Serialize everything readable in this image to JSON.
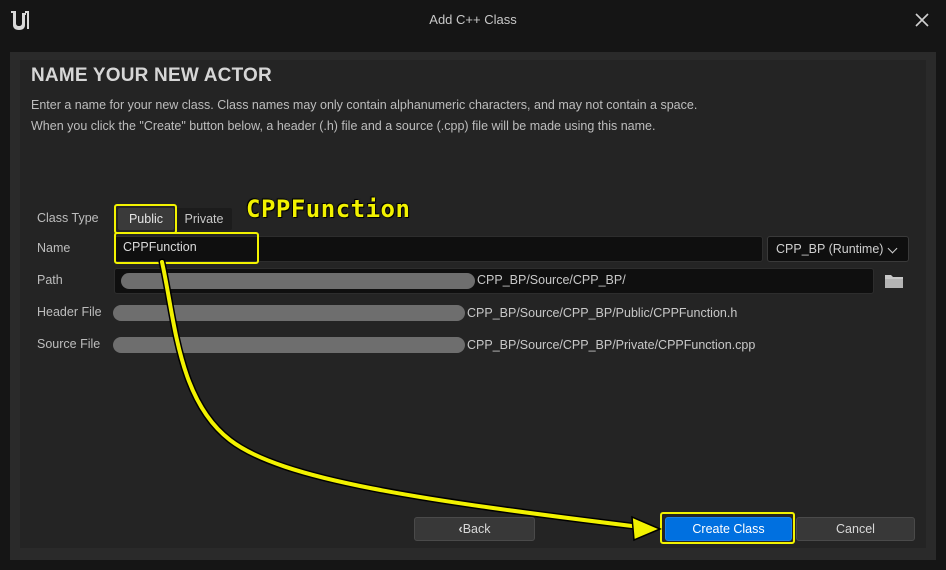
{
  "window": {
    "title": "Add C++ Class"
  },
  "page": {
    "heading": "NAME YOUR NEW ACTOR",
    "description_line1": "Enter a name for your new class. Class names may only contain alphanumeric characters, and may not contain a space.",
    "description_line2": "When you click the \"Create\" button below, a header (.h) file and a source (.cpp) file will be made using this name."
  },
  "form": {
    "class_type_label": "Class Type",
    "class_type_options": [
      "Public",
      "Private"
    ],
    "class_type_selected": "Public",
    "name_label": "Name",
    "name_value": "CPPFunction",
    "module_selected": "CPP_BP (Runtime)",
    "path_label": "Path",
    "path_visible": "CPP_BP/Source/CPP_BP/",
    "header_file_label": "Header File",
    "header_file_visible": "CPP_BP/Source/CPP_BP/Public/CPPFunction.h",
    "source_file_label": "Source File",
    "source_file_visible": "CPP_BP/Source/CPP_BP/Private/CPPFunction.cpp"
  },
  "buttons": {
    "back": "Back",
    "create": "Create Class",
    "cancel": "Cancel"
  },
  "annotation": {
    "text": "CPPFunction",
    "color": "#f2f200"
  },
  "colors": {
    "primary_button": "#0070e0",
    "highlight": "#f2f200",
    "background": "#242424"
  },
  "icons": [
    "unreal-logo-icon",
    "close-icon",
    "chevron-down-icon",
    "folder-icon",
    "chevron-left-icon"
  ]
}
